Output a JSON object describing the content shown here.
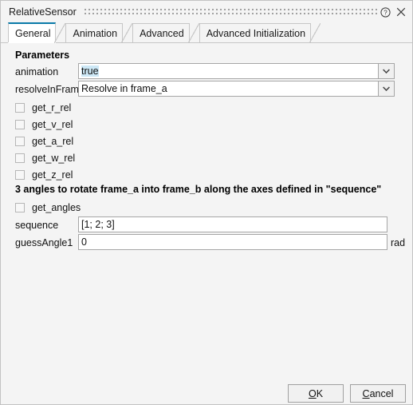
{
  "window": {
    "title": "RelativeSensor",
    "help_icon": "help-circle-icon",
    "close_icon": "close-icon",
    "grip": "drag-grip-dots"
  },
  "tabs": [
    {
      "label": "General",
      "active": true
    },
    {
      "label": "Animation",
      "active": false
    },
    {
      "label": "Advanced",
      "active": false
    },
    {
      "label": "Advanced Initialization",
      "active": false
    }
  ],
  "general": {
    "parameters_heading": "Parameters",
    "animation": {
      "label": "animation",
      "value": "true",
      "dropdown_icon": "chevron-down-icon"
    },
    "resolveInFrame": {
      "label": "resolveInFrame",
      "value": "Resolve in frame_a",
      "dropdown_icon": "chevron-down-icon"
    },
    "checkboxes": [
      {
        "label": "get_r_rel",
        "checked": false
      },
      {
        "label": "get_v_rel",
        "checked": false
      },
      {
        "label": "get_a_rel",
        "checked": false
      },
      {
        "label": "get_w_rel",
        "checked": false
      },
      {
        "label": "get_z_rel",
        "checked": false
      }
    ],
    "angles_heading": "3 angles to rotate frame_a into frame_b along the axes defined in \"sequence\"",
    "get_angles": {
      "label": "get_angles",
      "checked": false
    },
    "sequence": {
      "label": "sequence",
      "value": "[1; 2; 3]"
    },
    "guessAngle1": {
      "label": "guessAngle1",
      "value": "0",
      "unit": "rad"
    }
  },
  "footer": {
    "ok": {
      "pre": "",
      "mnemonic": "O",
      "post": "K"
    },
    "cancel": {
      "pre": "",
      "mnemonic": "C",
      "post": "ancel"
    }
  },
  "colors": {
    "accent": "#0a7aa8",
    "dialog_bg": "#f4f4f4",
    "field_bg": "#ffffff",
    "selection": "#cde8f6",
    "border": "#c6c6c6"
  }
}
